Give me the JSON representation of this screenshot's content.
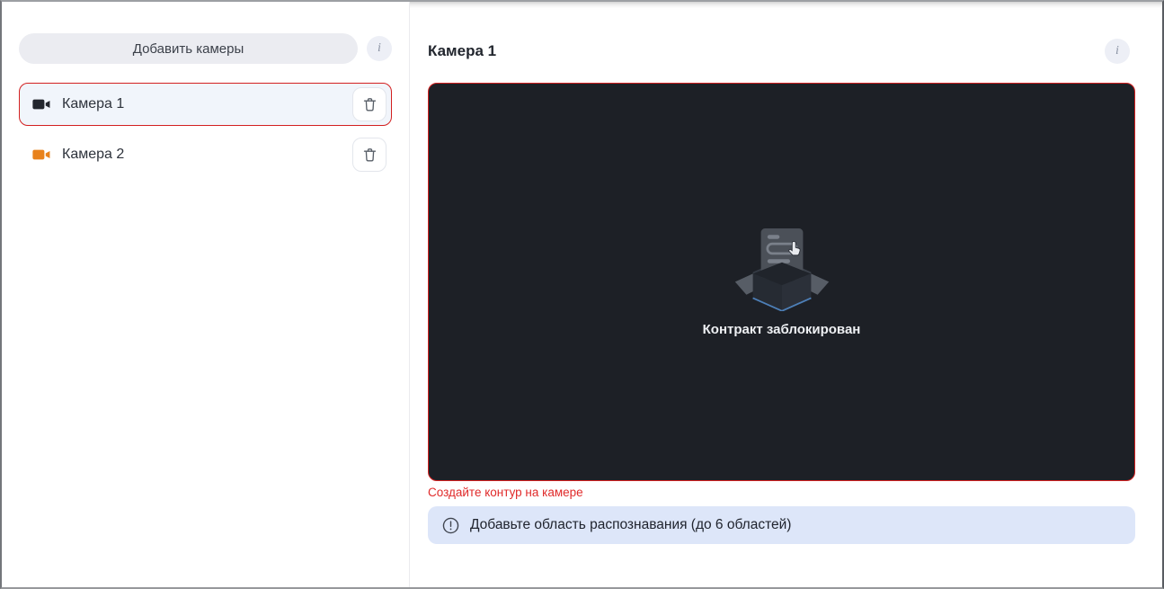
{
  "sidebar": {
    "add_cameras_button": "Добавить камеры",
    "info_button": "i",
    "cameras": [
      {
        "name": "Камера 1",
        "selected": true,
        "icon_color": "#23262d"
      },
      {
        "name": "Камера 2",
        "selected": false,
        "icon_color": "#e8821c"
      }
    ]
  },
  "main": {
    "title": "Камера 1",
    "info_button": "i",
    "empty_state": {
      "icon": "empty-box-icon",
      "message": "Контракт заблокирован"
    },
    "validation_error": "Создайте контур на камере",
    "hint_banner": {
      "icon": "alert-circle-icon",
      "text": "Добавьте область распознавания (до 6 областей)"
    }
  },
  "colors": {
    "accent-red": "#d32020",
    "selected-item-bg": "#f1f5fb",
    "video-bg": "#1d2026",
    "banner-bg": "#dde6f9",
    "error-text": "#e02a2a"
  }
}
